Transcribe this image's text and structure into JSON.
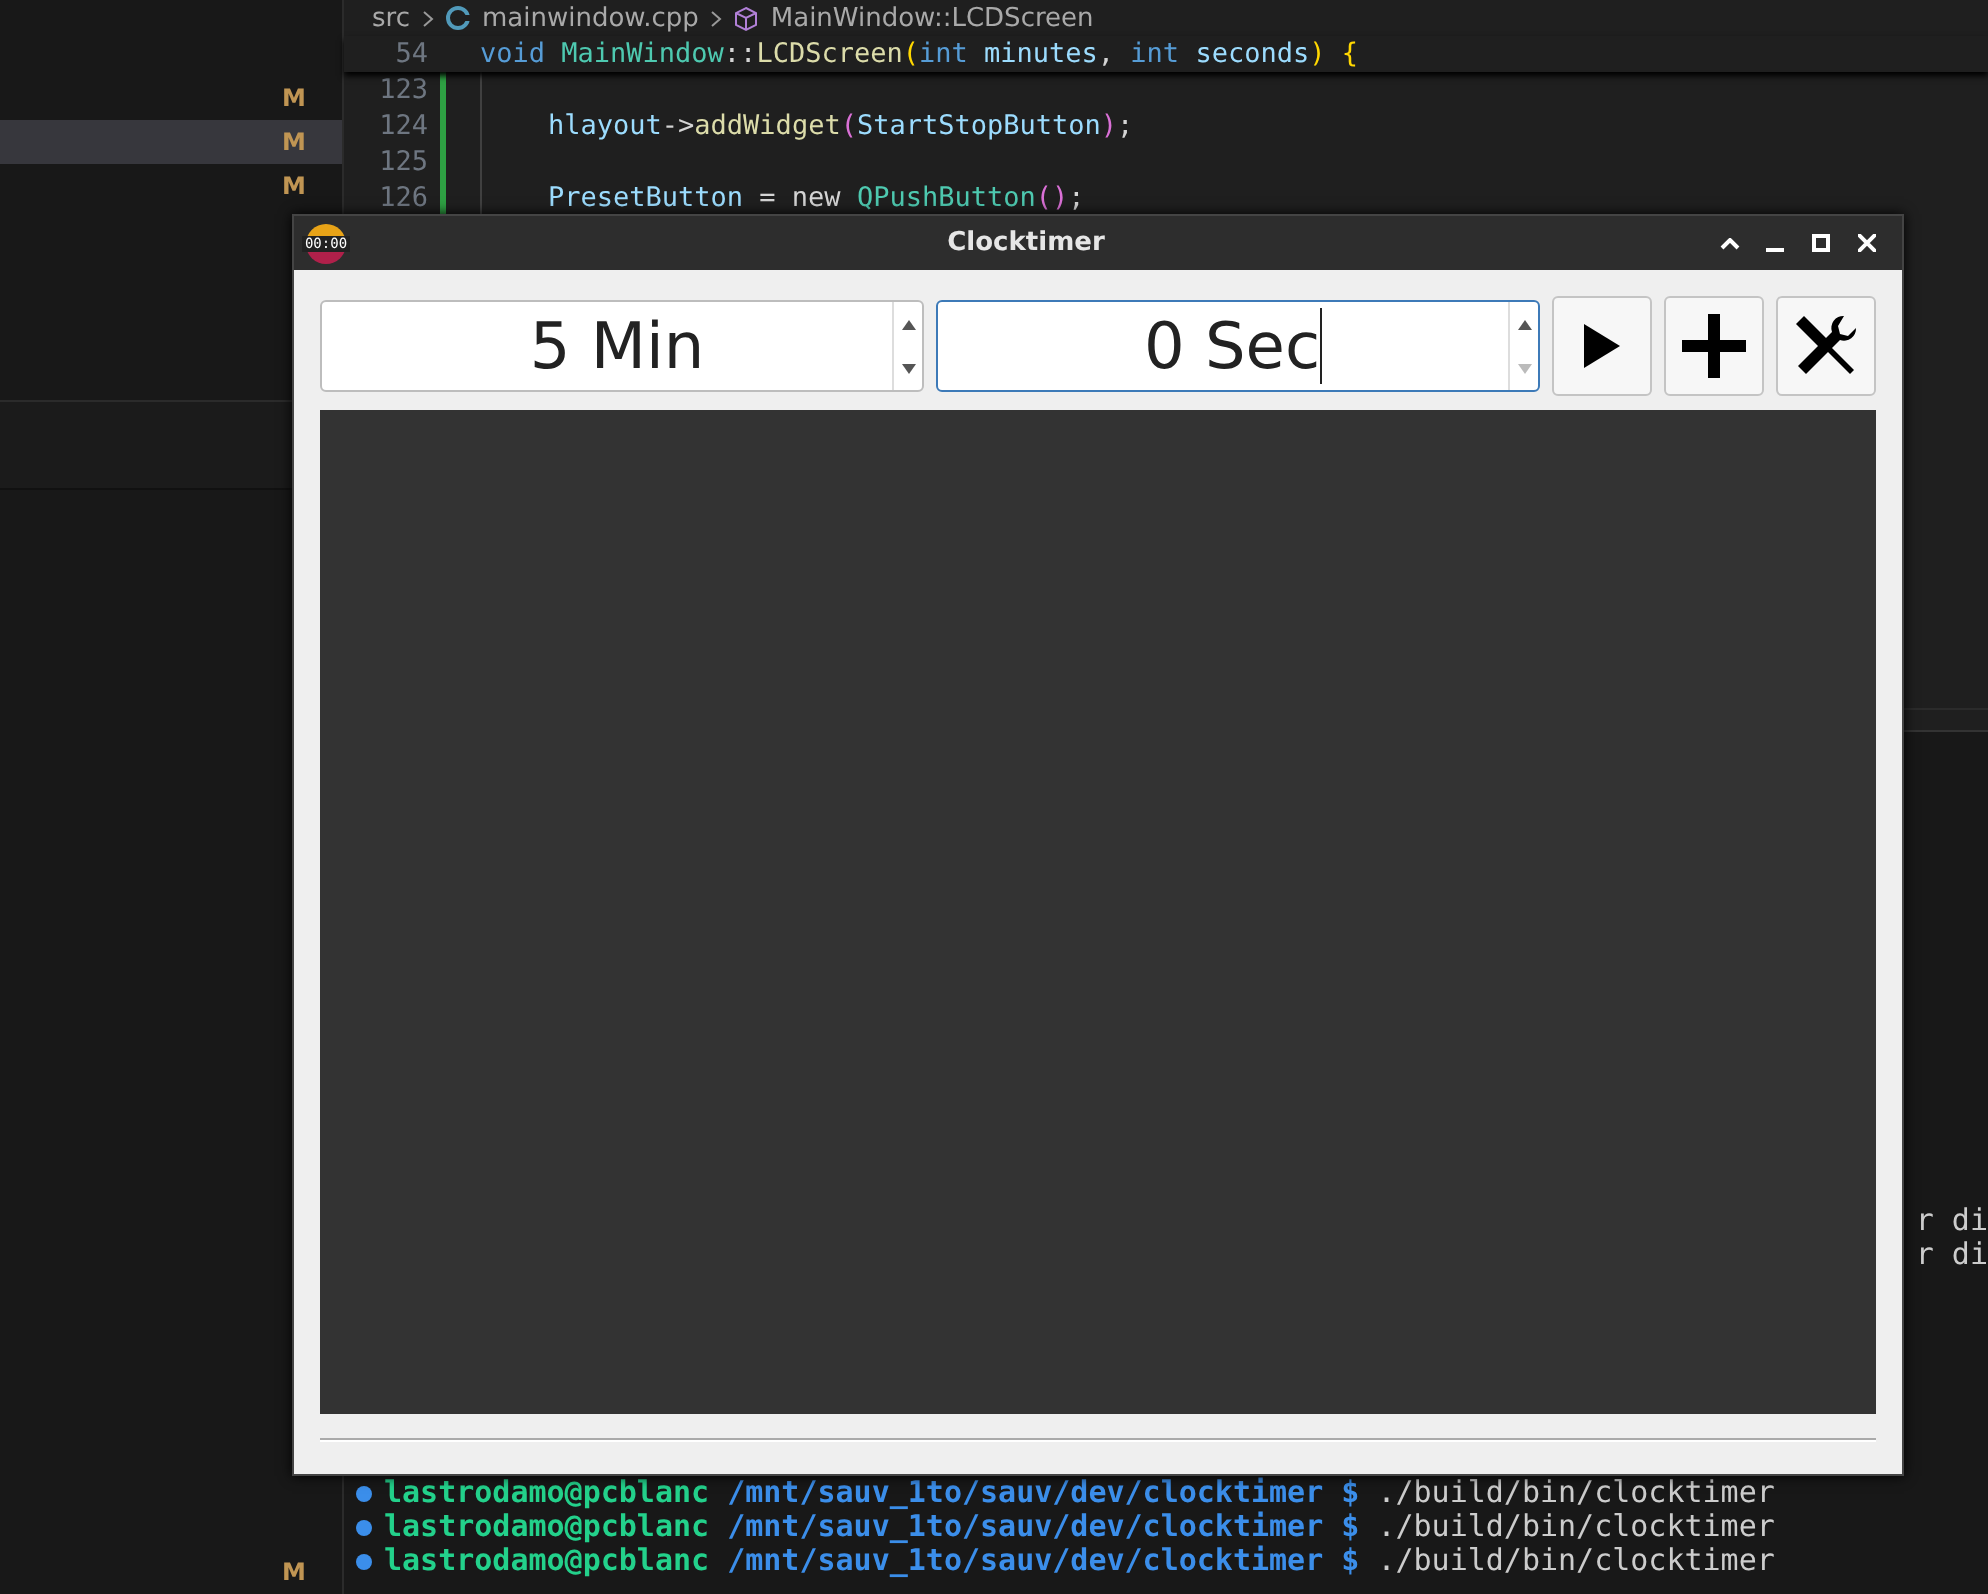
{
  "explorer": {
    "items": [
      {
        "badge": "M",
        "selected": false
      },
      {
        "badge": "M",
        "selected": true
      },
      {
        "badge": "M",
        "selected": false
      }
    ],
    "bottom_items": [
      {
        "badge": "M",
        "selected": false
      }
    ]
  },
  "editor": {
    "breadcrumbs": [
      "src",
      "mainwindow.cpp",
      "MainWindow::LCDScreen"
    ],
    "sticky_line": {
      "number": "54",
      "tokens": [
        {
          "kind": "keyword",
          "text": "void "
        },
        {
          "kind": "type",
          "text": "MainWindow"
        },
        {
          "kind": "plain",
          "text": "::"
        },
        {
          "kind": "function",
          "text": "LCDScreen"
        },
        {
          "kind": "bracket",
          "text": "("
        },
        {
          "kind": "keyword",
          "text": "int "
        },
        {
          "kind": "variable",
          "text": "minutes"
        },
        {
          "kind": "plain",
          "text": ", "
        },
        {
          "kind": "keyword",
          "text": "int "
        },
        {
          "kind": "variable",
          "text": "seconds"
        },
        {
          "kind": "bracket",
          "text": ") {"
        }
      ]
    },
    "lines": [
      {
        "number": "123"
      },
      {
        "number": "124",
        "tokens": [
          {
            "kind": "variable",
            "text": "hlayout"
          },
          {
            "kind": "plain",
            "text": "->"
          },
          {
            "kind": "function",
            "text": "addWidget"
          },
          {
            "kind": "bracket2",
            "text": "("
          },
          {
            "kind": "variable",
            "text": "StartStopButton"
          },
          {
            "kind": "bracket2",
            "text": ")"
          },
          {
            "kind": "plain",
            "text": ";"
          }
        ]
      },
      {
        "number": "125"
      },
      {
        "number": "126",
        "tokens": [
          {
            "kind": "variable",
            "text": "PresetButton"
          },
          {
            "kind": "plain",
            "text": " = new "
          },
          {
            "kind": "type",
            "text": "QPushButton"
          },
          {
            "kind": "bracket2",
            "text": "()"
          },
          {
            "kind": "plain",
            "text": ";"
          }
        ]
      }
    ]
  },
  "terminal": {
    "output_fragments": [
      "r di",
      "r di"
    ],
    "lines": [
      {
        "user": "lastrodamo@pcblanc",
        "path": "/mnt/sauv_1to/sauv/dev/clocktimer",
        "prompt": "$",
        "command": "./build/bin/clocktimer"
      },
      {
        "user": "lastrodamo@pcblanc",
        "path": "/mnt/sauv_1to/sauv/dev/clocktimer",
        "prompt": "$",
        "command": "./build/bin/clocktimer"
      },
      {
        "user": "lastrodamo@pcblanc",
        "path": "/mnt/sauv_1to/sauv/dev/clocktimer",
        "prompt": "$",
        "command": "./build/bin/clocktimer"
      }
    ]
  },
  "window": {
    "title": "Clocktimer",
    "icon_text": "00:00",
    "spinboxes": [
      {
        "value": "5 Min",
        "focused": false,
        "down_disabled": false
      },
      {
        "value": "0 Sec",
        "focused": true,
        "down_disabled": true
      }
    ],
    "buttons": [
      {
        "kind": "play"
      },
      {
        "kind": "add"
      },
      {
        "kind": "tools"
      }
    ]
  }
}
